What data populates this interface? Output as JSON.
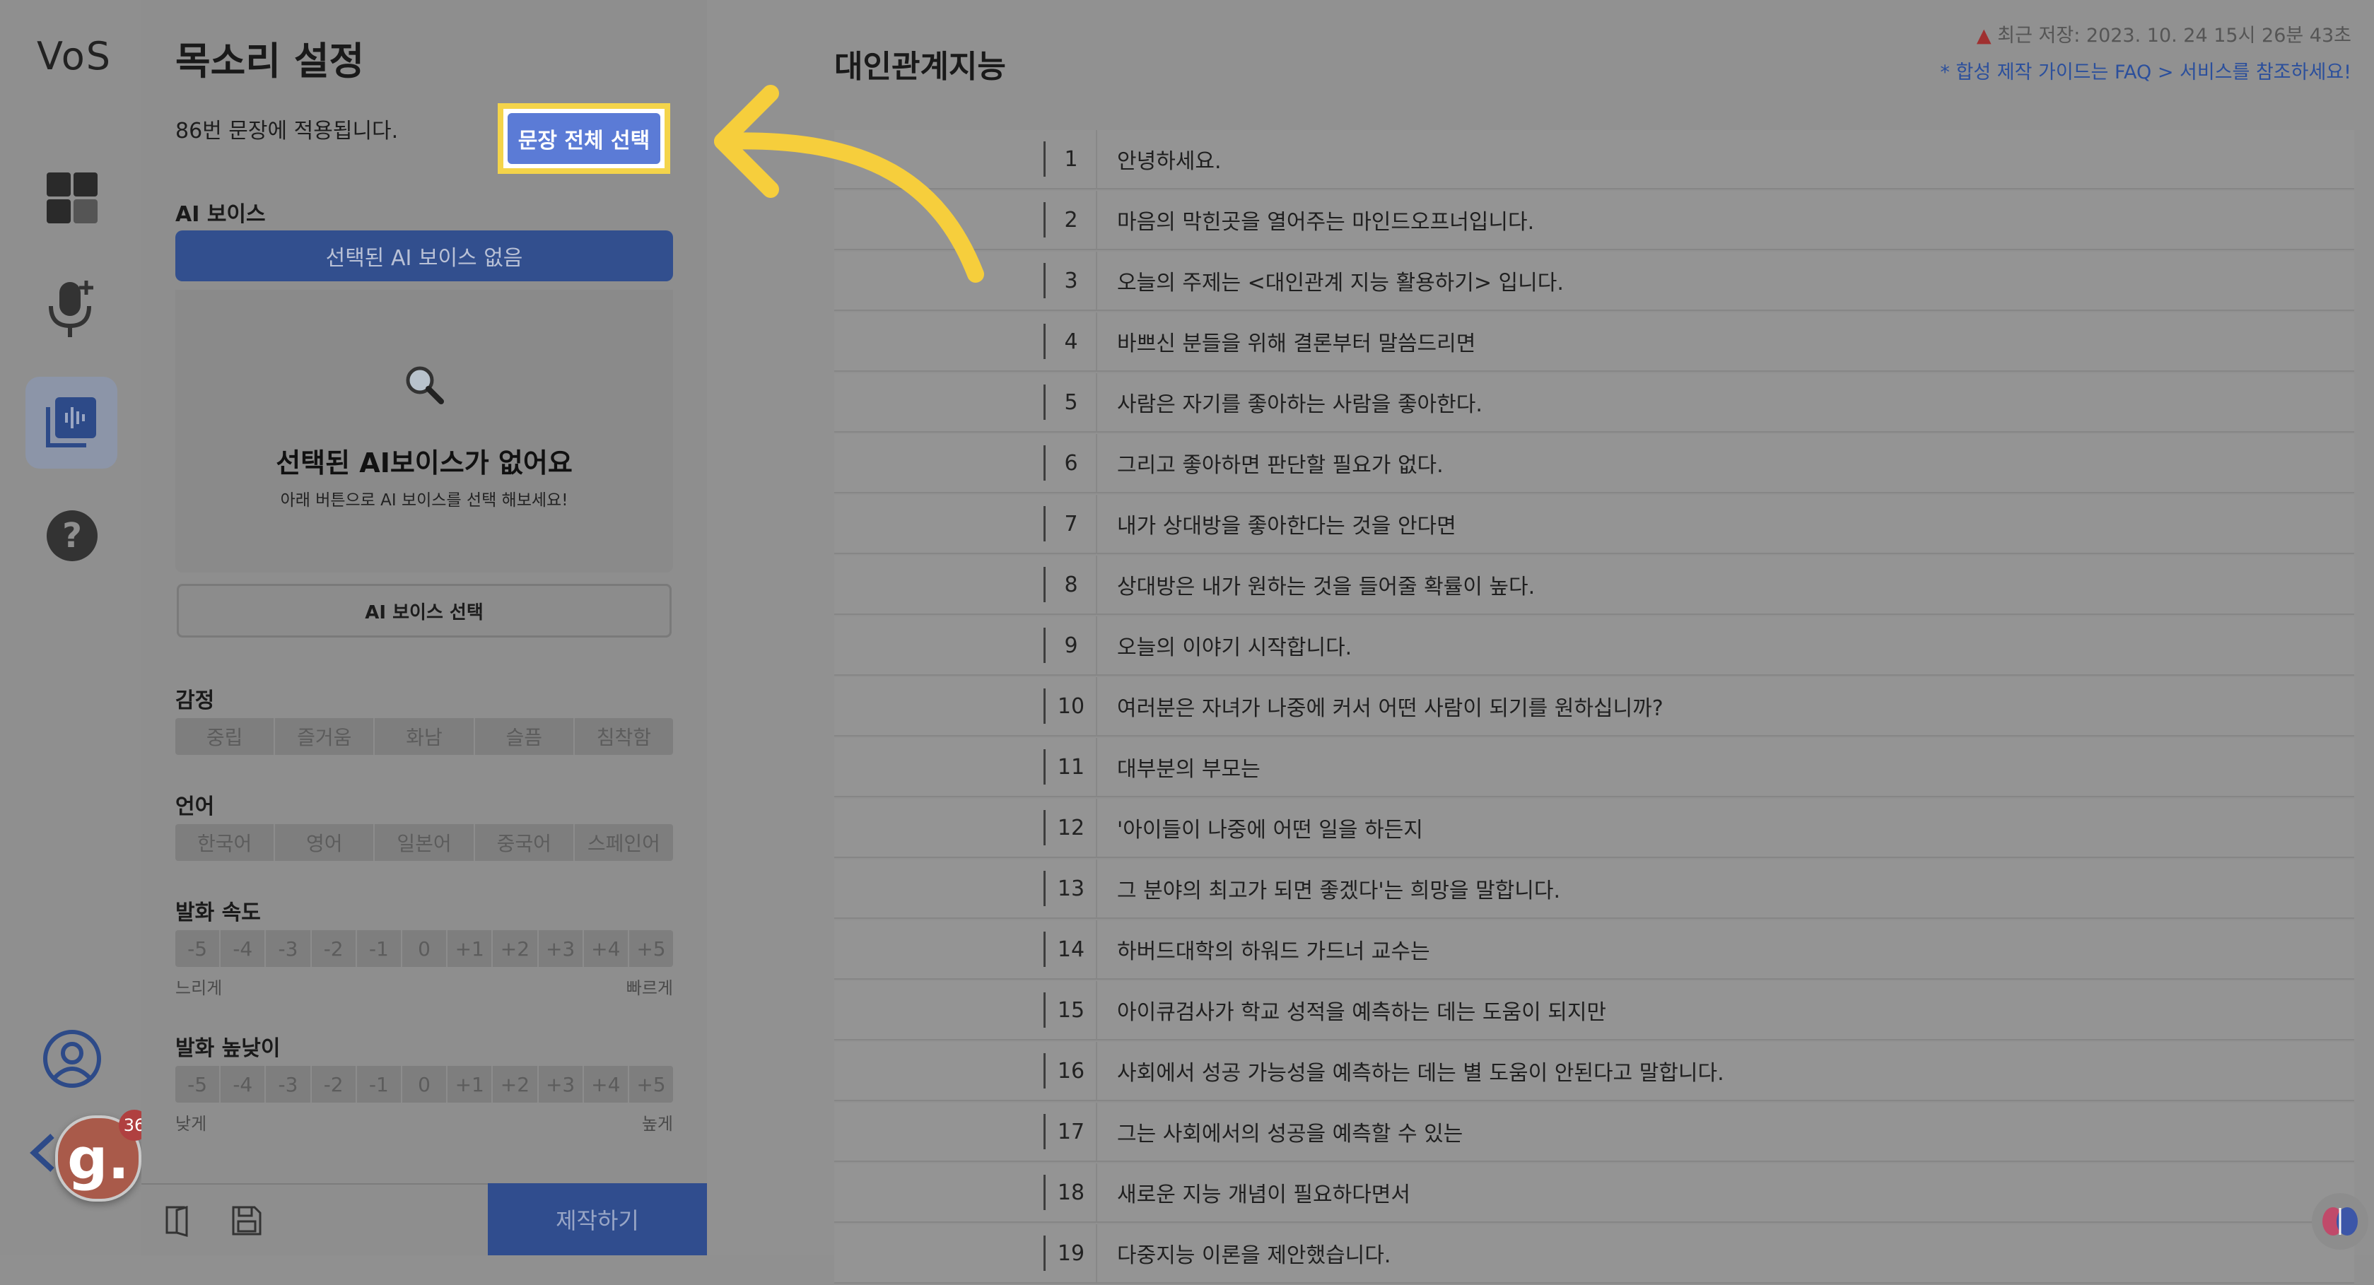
{
  "app": {
    "logo": "VoS"
  },
  "panel": {
    "title": "목소리 설정",
    "subtitle": "86번 문장에 적용됩니다.",
    "select_all_label": "문장 전체 선택",
    "ai_voice_label": "AI 보이스",
    "ai_voice_selected": "선택된 AI 보이스 없음",
    "empty_heading": "선택된 AI보이스가 없어요",
    "empty_sub": "아래 버튼으로 AI 보이스를 선택 해보세요!",
    "ai_select_button": "AI 보이스 선택",
    "emotion_label": "감정",
    "emotions": [
      "중립",
      "즐거움",
      "화남",
      "슬픔",
      "침착함"
    ],
    "language_label": "언어",
    "languages": [
      "한국어",
      "영어",
      "일본어",
      "중국어",
      "스페인어"
    ],
    "speed_label": "발화 속도",
    "speed_scale": [
      "-5",
      "-4",
      "-3",
      "-2",
      "-1",
      "0",
      "+1",
      "+2",
      "+3",
      "+4",
      "+5"
    ],
    "speed_min": "느리게",
    "speed_max": "빠르게",
    "pitch_label": "발화 높낮이",
    "pitch_scale": [
      "-5",
      "-4",
      "-3",
      "-2",
      "-1",
      "0",
      "+1",
      "+2",
      "+3",
      "+4",
      "+5"
    ],
    "pitch_min": "낮게",
    "pitch_max": "높게",
    "make_button": "제작하기"
  },
  "main": {
    "title": "대인관계지능",
    "last_saved": "최근 저장: 2023. 10. 24 15시 26분 43초",
    "guide": "* 합성 제작 가이드는 FAQ > 서비스를 참조하세요!",
    "sentences": [
      {
        "num": "1",
        "text": "안녕하세요."
      },
      {
        "num": "2",
        "text": "마음의 막힌곳을 열어주는 마인드오프너입니다."
      },
      {
        "num": "3",
        "text": "오늘의 주제는 <대인관계 지능 활용하기> 입니다."
      },
      {
        "num": "4",
        "text": "바쁘신 분들을 위해 결론부터 말씀드리면"
      },
      {
        "num": "5",
        "text": "사람은 자기를 좋아하는 사람을 좋아한다."
      },
      {
        "num": "6",
        "text": "그리고 좋아하면 판단할 필요가 없다."
      },
      {
        "num": "7",
        "text": "내가 상대방을 좋아한다는 것을 안다면"
      },
      {
        "num": "8",
        "text": "상대방은 내가 원하는 것을 들어줄 확률이 높다."
      },
      {
        "num": "9",
        "text": "오늘의 이야기 시작합니다."
      },
      {
        "num": "10",
        "text": "여러분은 자녀가 나중에 커서 어떤 사람이 되기를 원하십니까?"
      },
      {
        "num": "11",
        "text": "대부분의 부모는"
      },
      {
        "num": "12",
        "text": "'아이들이 나중에 어떤 일을 하든지"
      },
      {
        "num": "13",
        "text": "그 분야의 최고가 되면 좋겠다'는 희망을 말합니다."
      },
      {
        "num": "14",
        "text": "하버드대학의 하워드 가드너 교수는"
      },
      {
        "num": "15",
        "text": "아이큐검사가 학교 성적을 예측하는 데는 도움이 되지만"
      },
      {
        "num": "16",
        "text": "사회에서 성공 가능성을 예측하는 데는 별 도움이 안된다고 말합니다."
      },
      {
        "num": "17",
        "text": "그는 사회에서의 성공을 예측할 수 있는"
      },
      {
        "num": "18",
        "text": "새로운 지능 개념이 필요하다면서"
      },
      {
        "num": "19",
        "text": "다중지능 이론을 제안했습니다."
      }
    ]
  },
  "badge": {
    "letter": "g.",
    "count": "36"
  },
  "colors": {
    "highlight": "#f4d44a",
    "primary": "#5b7bd6",
    "arrow": "#f6ce3c"
  }
}
